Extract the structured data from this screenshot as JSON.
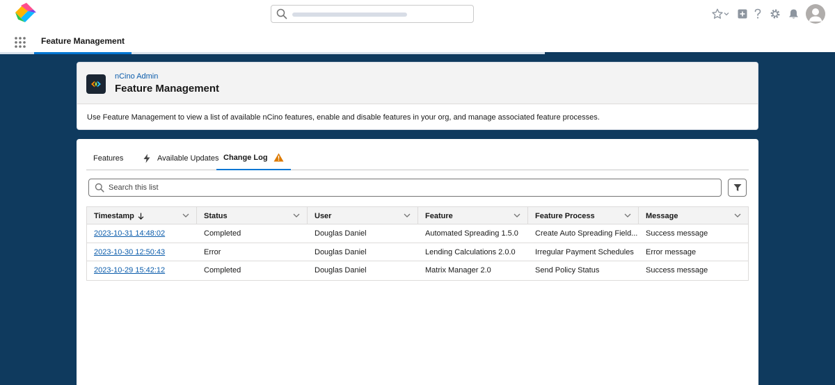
{
  "header": {
    "search_placeholder": "",
    "icons": [
      "favorites-star-icon",
      "chevron-down-icon",
      "add-icon",
      "help-icon",
      "setup-gear-icon",
      "notifications-bell-icon",
      "avatar-icon"
    ]
  },
  "nav": {
    "tab_label": "Feature Management"
  },
  "page_header": {
    "app_name": "nCino Admin",
    "title": "Feature Management",
    "description": "Use Feature Management to view a list of available nCino features, enable and disable features in your org, and manage associated feature processes."
  },
  "tabs": [
    {
      "label": "Features"
    },
    {
      "label": "Available Updates",
      "icon": "lightning-icon"
    },
    {
      "label": "Change Log",
      "icon": "warning-icon",
      "active": true
    }
  ],
  "list": {
    "search_placeholder": "Search this list"
  },
  "table": {
    "columns": [
      "Timestamp",
      "Status",
      "User",
      "Feature",
      "Feature Process",
      "Message"
    ],
    "rows": [
      [
        "2023-10-31 14:48:02",
        "Completed",
        "Douglas Daniel",
        "Automated Spreading 1.5.0",
        "Create Auto Spreading Field...",
        "Success message"
      ],
      [
        "2023-10-30 12:50:43",
        "Error",
        "Douglas Daniel",
        "Lending Calculations 2.0.0",
        "Irregular Payment Schedules",
        "Error message"
      ],
      [
        "2023-10-29 15:42:12",
        "Completed",
        "Douglas Daniel",
        "Matrix Manager 2.0",
        "Send Policy Status",
        "Success message"
      ]
    ]
  },
  "colors": {
    "page_background": "#0f3a5e",
    "accent": "#0176d3",
    "link": "#0b5cab",
    "warning": "#dd7a01"
  }
}
